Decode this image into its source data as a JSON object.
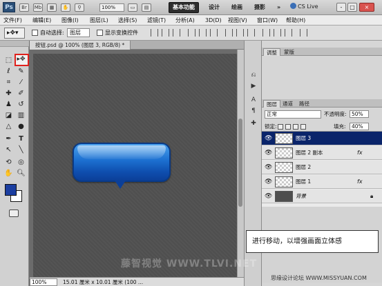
{
  "app": {
    "logo": "Ps",
    "zoom": "100%",
    "workspaces": [
      "基本功能",
      "设计",
      "绘画",
      "摄影"
    ],
    "cs_live": "CS Live",
    "window_buttons": [
      "-",
      "□",
      "×"
    ]
  },
  "menu": [
    "文件(F)",
    "编辑(E)",
    "图像(I)",
    "图层(L)",
    "选择(S)",
    "滤镜(T)",
    "分析(A)",
    "3D(D)",
    "视图(V)",
    "窗口(W)",
    "帮助(H)"
  ],
  "options": {
    "auto_select_label": "自动选择:",
    "auto_select_value": "图层",
    "show_transform_label": "显示变换控件"
  },
  "document": {
    "tab_title": "按钮.psd @ 100% (图层 3, RGB/8) *",
    "status_zoom": "100%",
    "status_info": "15.01 厘米 x 10.01 厘米 (100 ..."
  },
  "panels": {
    "top_tabs": [
      "调整",
      "蒙版"
    ],
    "layer_tabs": [
      "图层",
      "通道",
      "路径"
    ],
    "blend_mode": "正常",
    "opacity_label": "不透明度:",
    "opacity_value": "50%",
    "lock_label": "锁定:",
    "fill_label": "填充:",
    "fill_value": "40%",
    "layers": [
      {
        "name": "图层 3",
        "selected": true,
        "fx": false
      },
      {
        "name": "图层 2 副本",
        "selected": false,
        "fx": true
      },
      {
        "name": "图层 2",
        "selected": false,
        "fx": false
      },
      {
        "name": "图层 1",
        "selected": false,
        "fx": true
      },
      {
        "name": "背景",
        "selected": false,
        "fx": false
      }
    ]
  },
  "caption": "进行移动，以增强画面立体感",
  "watermark": "藤智视觉 WWW.TLVI.NET",
  "credit": "思缘设计论坛 WWW.MISSYUAN.COM"
}
